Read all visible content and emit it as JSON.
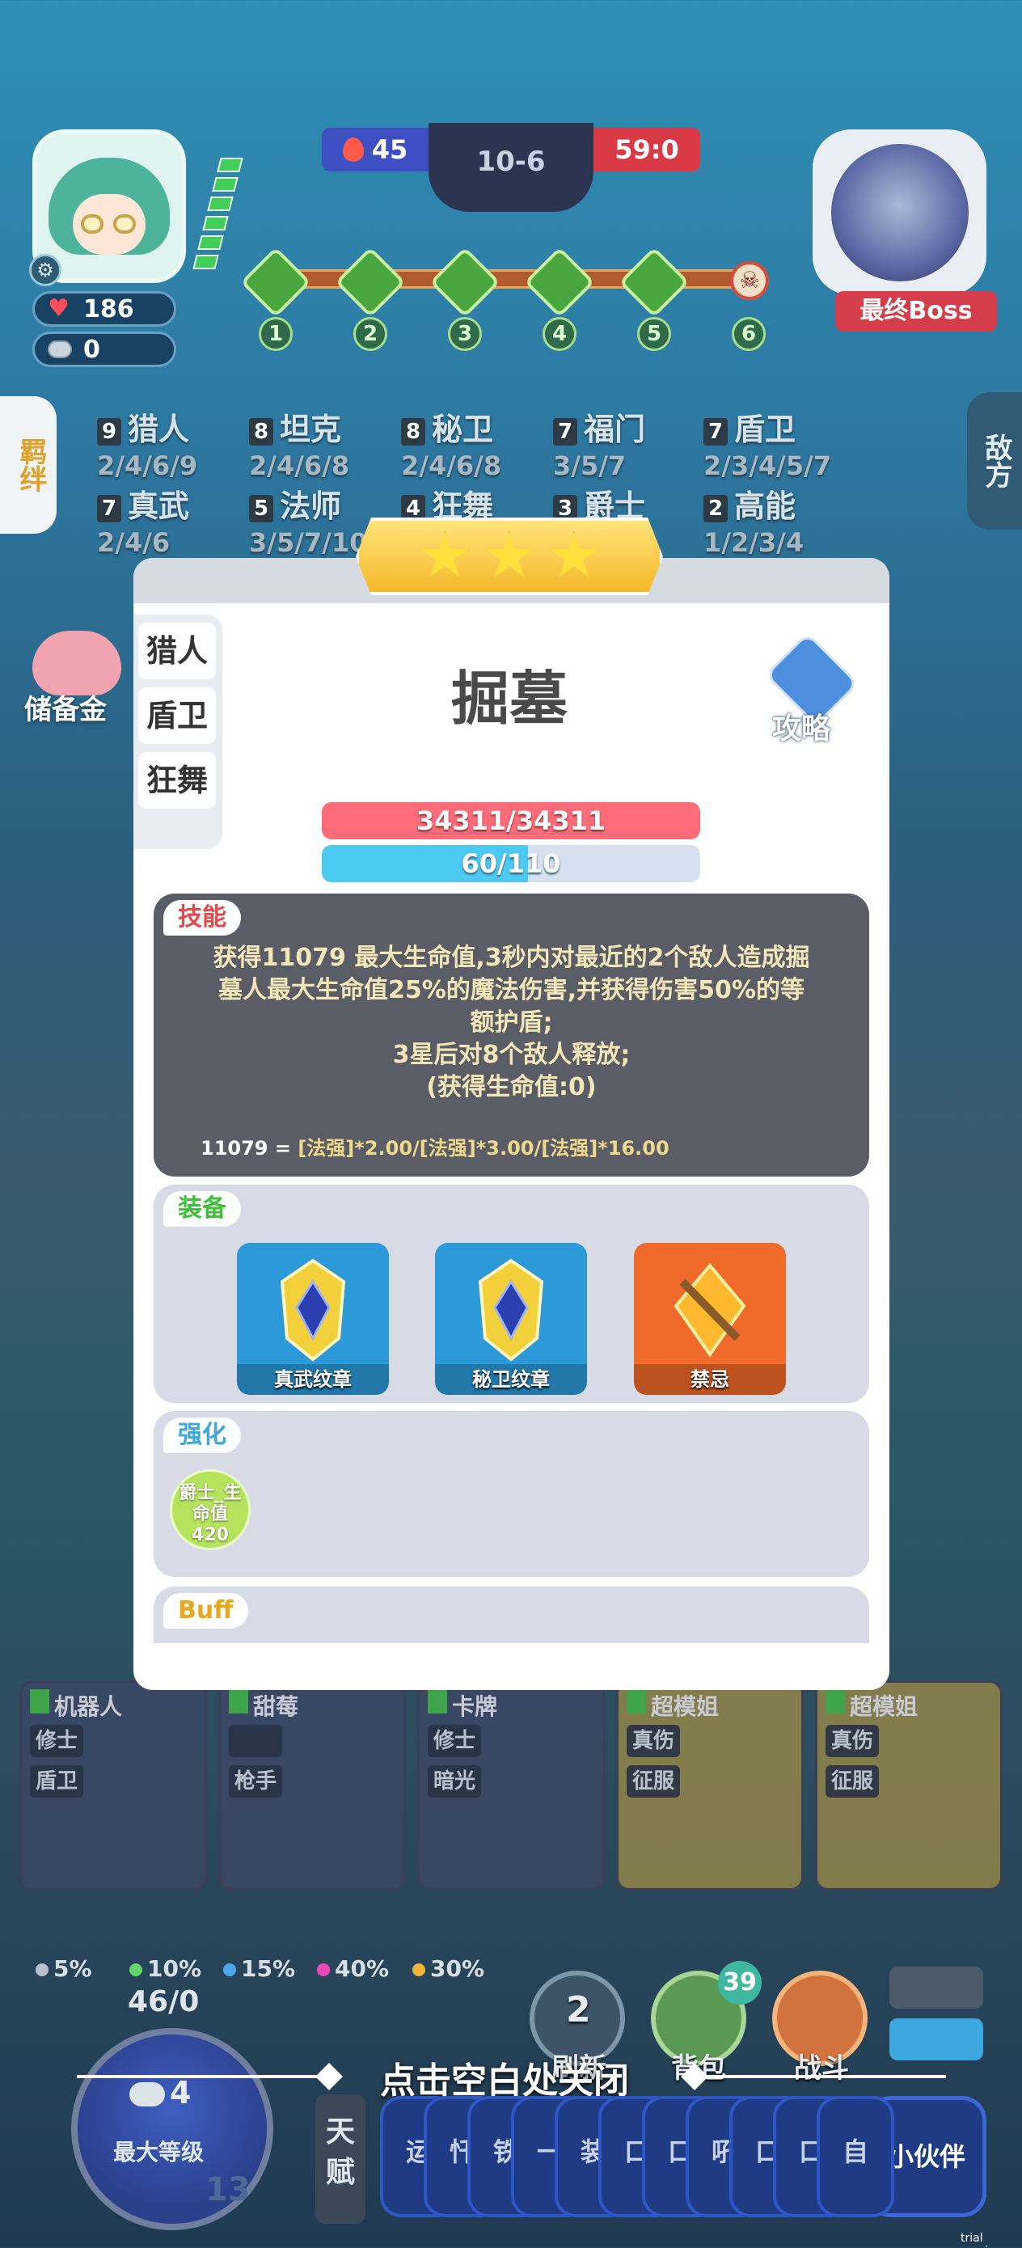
{
  "player": {
    "hp": "186",
    "gold": "0"
  },
  "score": {
    "left": "45",
    "round": "10-6",
    "right": "59:0"
  },
  "stages": [
    "1",
    "2",
    "3",
    "4",
    "5",
    "6"
  ],
  "boss": {
    "label": "最终Boss"
  },
  "side_tabs": {
    "left": "羁绊",
    "right": "敌方"
  },
  "synergies": [
    {
      "count": "9",
      "name": "猎人",
      "tiers": "2/4/6/9"
    },
    {
      "count": "8",
      "name": "坦克",
      "tiers": "2/4/6/8"
    },
    {
      "count": "8",
      "name": "秘卫",
      "tiers": "2/4/6/8"
    },
    {
      "count": "7",
      "name": "福门",
      "tiers": "3/5/7"
    },
    {
      "count": "7",
      "name": "盾卫",
      "tiers": "2/3/4/5/7"
    },
    {
      "count": "7",
      "name": "真武",
      "tiers": "2/4/6"
    },
    {
      "count": "5",
      "name": "法师",
      "tiers": "3/5/7/10"
    },
    {
      "count": "4",
      "name": "狂舞",
      "tiers": ""
    },
    {
      "count": "3",
      "name": "爵士",
      "tiers": ""
    },
    {
      "count": "2",
      "name": "高能",
      "tiers": "1/2/3/4"
    }
  ],
  "reserve_label": "储备金",
  "modal": {
    "class_tabs": [
      "猎人",
      "盾卫",
      "狂舞"
    ],
    "unit_name": "掘墓",
    "guide_label": "攻略",
    "hp_text": "34311/34311",
    "mp_text": "60/110",
    "mp_fraction": 0.545,
    "skill": {
      "tag": "技能",
      "lines": [
        "获得11079 最大生命值,3秒内对最近的2个敌人造成掘",
        "墓人最大生命值25%的魔法伤害,并获得伤害50%的等",
        "额护盾;",
        "3星后对8个敌人释放;",
        "(获得生命值:0)"
      ],
      "formula_value": "11079 = ",
      "formula": "[法强]*2.00/[法强]*3.00/[法强]*16.00"
    },
    "equip": {
      "tag": "装备",
      "items": [
        {
          "label": "真武纹章",
          "bg": "#2c9ad8"
        },
        {
          "label": "秘卫纹章",
          "bg": "#2c9ad8"
        },
        {
          "label": "禁忌",
          "bg": "#f06a2a"
        }
      ]
    },
    "enhance": {
      "tag": "强化",
      "badge_line1": "爵士_生",
      "badge_line2": "命值",
      "badge_value": "420"
    },
    "buff": {
      "tag": "Buff"
    }
  },
  "bench": [
    {
      "name": "机器人",
      "traits": [
        "修士",
        "盾卫"
      ]
    },
    {
      "name": "甜莓",
      "traits": [
        "",
        "枪手"
      ]
    },
    {
      "name": "卡牌",
      "traits": [
        "修士",
        "暗光"
      ]
    },
    {
      "name": "超模姐",
      "traits": [
        "真伤",
        "征服"
      ]
    },
    {
      "name": "超模姐",
      "traits": [
        "真伤",
        "征服"
      ]
    }
  ],
  "odds": [
    {
      "value": "5%",
      "color": "#b8c2cc"
    },
    {
      "value": "10%",
      "color": "#5fd76a"
    },
    {
      "value": "15%",
      "color": "#4aa7e8"
    },
    {
      "value": "40%",
      "color": "#ec4ab8"
    },
    {
      "value": "30%",
      "color": "#f0b43a"
    }
  ],
  "level": {
    "xp": "46/0",
    "cost": "4",
    "label": "最大等级",
    "num": "13"
  },
  "buttons": {
    "refresh_count": "2",
    "refresh_label": "刷新",
    "bag_label": "背包",
    "bag_count": "39",
    "fight_label": "战斗"
  },
  "close_hint": "点击空白处关闭",
  "talent_label": "天赋",
  "chips": [
    "运",
    "忏",
    "铁",
    "一",
    "装",
    "口",
    "口",
    "吼",
    "口",
    "口",
    "自"
  ],
  "partner_label": "小伙伴",
  "watermark": "trial version"
}
